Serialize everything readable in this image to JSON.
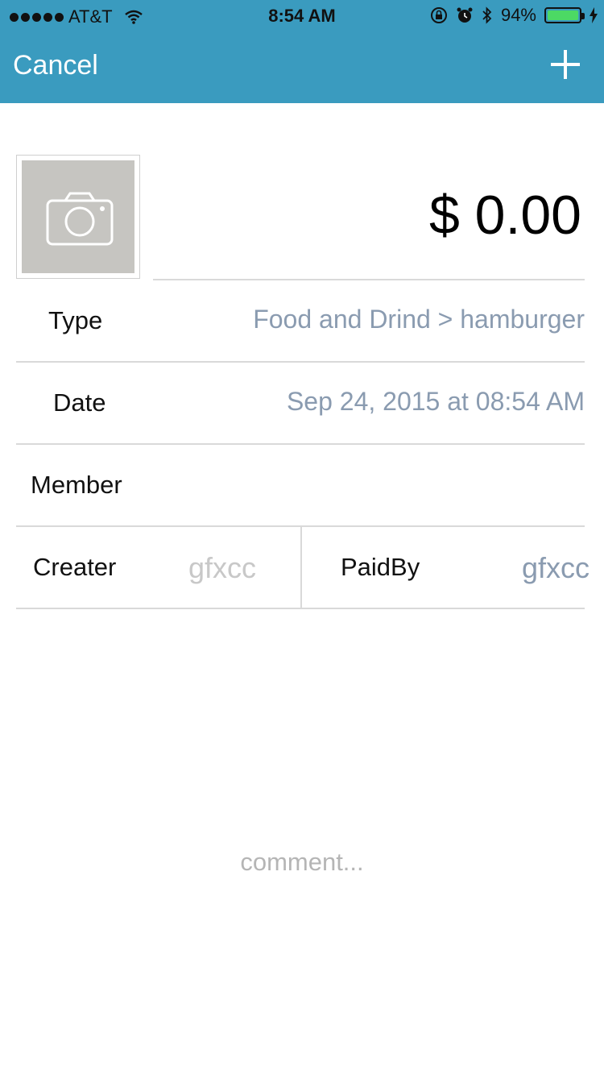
{
  "status_bar": {
    "carrier": "AT&T",
    "time": "8:54 AM",
    "battery": "94%",
    "battery_level": 0.94
  },
  "nav": {
    "cancel_label": "Cancel",
    "add_icon": "plus-icon"
  },
  "photo": {
    "icon": "camera-icon"
  },
  "amount": "$ 0.00",
  "fields": {
    "type_label": "Type",
    "type_value": "Food and Drind > hamburger",
    "date_label": "Date",
    "date_value": "Sep 24, 2015 at 08:54 AM",
    "member_label": "Member",
    "creater_label": "Creater",
    "creater_value": "gfxcc",
    "paidby_label": "PaidBy",
    "paidby_value": "gfxcc"
  },
  "comment_placeholder": "comment...",
  "colors": {
    "nav_background": "#3a9bbf",
    "value_text": "#8a9bb0",
    "battery_fill": "#4cd964"
  }
}
